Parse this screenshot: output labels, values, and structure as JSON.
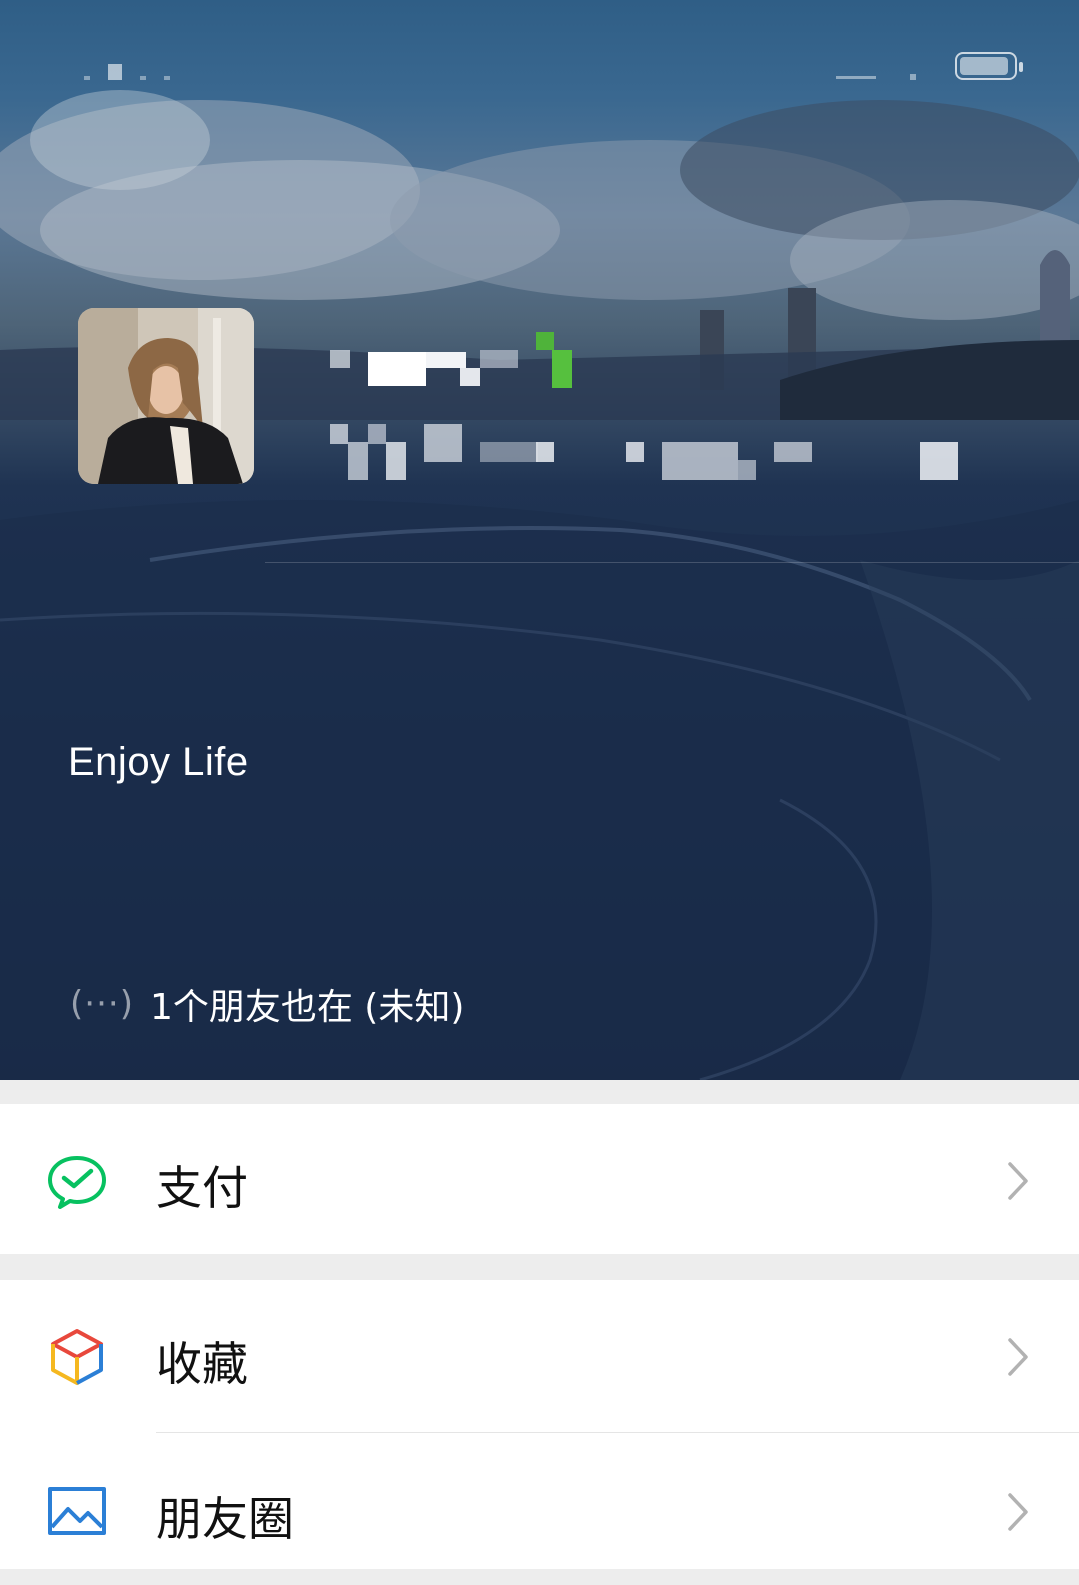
{
  "profile": {
    "bio": "Enjoy Life",
    "friends_status": "1个朋友也在 (未知)",
    "friends_icon": "ellipsis-status-icon"
  },
  "menu": {
    "pay_label": "支付",
    "favorites_label": "收藏",
    "moments_label": "朋友圈"
  },
  "colors": {
    "pay_icon": "#07c160",
    "moments_icon": "#2b7fd6",
    "chevron": "#b2b2b2"
  }
}
